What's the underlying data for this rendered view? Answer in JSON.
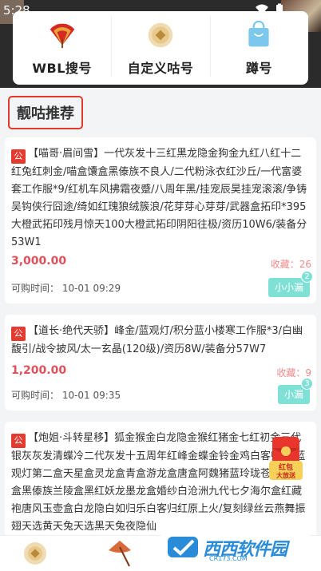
{
  "status_bar": {
    "time": "5:28"
  },
  "menu": [
    {
      "label": "WBL搜号",
      "icon": "fan-icon"
    },
    {
      "label": "自定义咕号",
      "icon": "coin-icon"
    },
    {
      "label": "蹲号",
      "icon": "bag-icon"
    }
  ],
  "section_title": "靓咕推荐",
  "listings": [
    {
      "badge": "公",
      "title": "【喵哥·眉间雪】",
      "description": "一代灰发十三红黑龙隐金狗金九红八红十二红兔红刺金/喵盒馕盒黑傣族不良人/二代粉泳衣红沙丘/一代富婆套工作服*9/红机车风拂霜夜蹙/八周年黑/挂宠辰昊挂宠滚滚/争铸吴钩侠行囧途/绮如红瑰狼绒簇浪/花芽芽心芽芽/武器盒拓印*395大橙武拓印残月惊天100大橙武拓印阴阳往极/资历10W6/装备分53W1",
      "price": "3,000.00",
      "favorites": "收藏：26",
      "time": "可购时间：  10-01 09:29",
      "chip": "小小漏",
      "chip_count": "2"
    },
    {
      "badge": "公",
      "title": "【道长·绝代天骄】",
      "description": "峰金/蓝观灯/积分蓝小楼寒工作服*3/白幽馥引/战令披风/太一玄晶(120级)/资历8W/装备分57W7",
      "price": "1,200.00",
      "favorites": "收藏：9",
      "time": "可购时间：  10-01 09:35",
      "chip": "小漏",
      "chip_count": "3"
    },
    {
      "badge": "公",
      "title": "【炮姐·斗转星移】",
      "description": "狐金猴金白龙隐金猴红猪金七红初金三代银灰灰发清蝶冷二代灰发十五周年红峰金蝶金铃金鸡白客归金/蓝观灯第二盒天星盒灵龙盒青盒游龙盒唐盒阿魏猪蓝玲珑苍盒苍二盒黑傣族兰陵盒黑红妖龙墨龙盒婚纱白沧洲九代七夕海尔盒红藏袍唐风玉壶盒白龙隐白如归乐白客归红原上火/复刻绿丝云燕舞振翅天选黄天兔天选黑天兔夜隐仙",
      "price": "",
      "favorites": "",
      "time": "",
      "chip": "",
      "chip_count": ""
    }
  ],
  "float_badge": {
    "line1": "红包",
    "line2": "大放送"
  },
  "watermark": {
    "text": "西西软件园",
    "url": "CR173.COM"
  },
  "colors": {
    "accent_red": "#e53a30",
    "price_red": "#e0505a",
    "chip_teal": "#7fe0d6",
    "section_border": "#e03a2a"
  }
}
